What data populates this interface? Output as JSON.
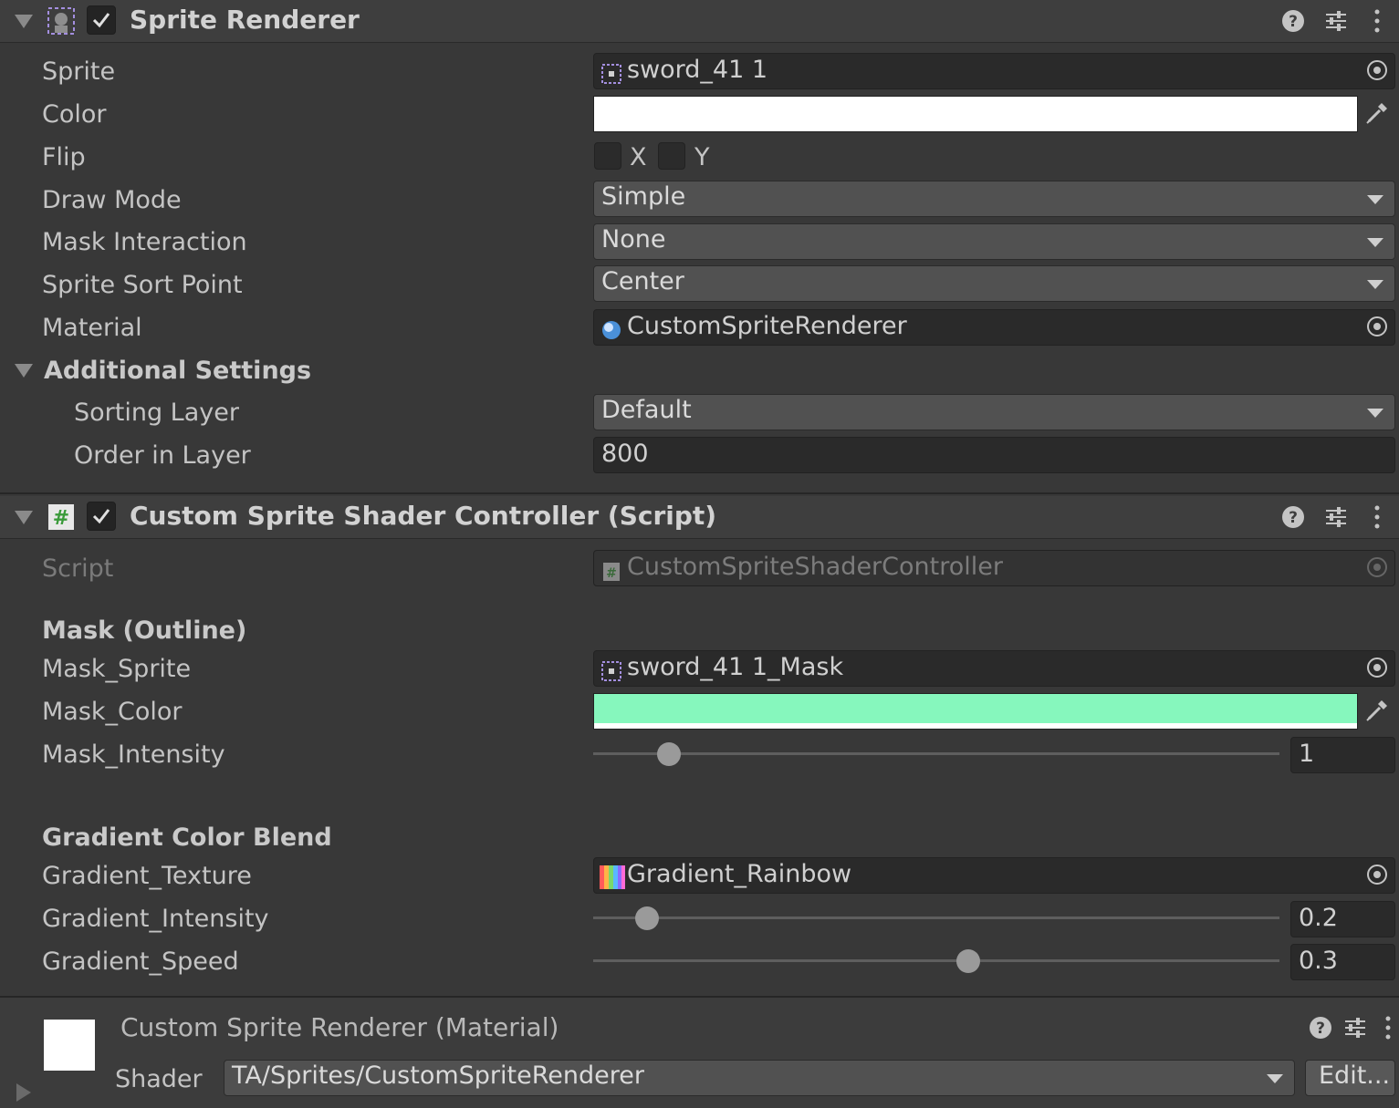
{
  "sprite_renderer": {
    "title": "Sprite Renderer",
    "enabled": true,
    "fields": {
      "sprite_label": "Sprite",
      "sprite_value": "sword_41 1",
      "color_label": "Color",
      "color_value": "#ffffff",
      "flip_label": "Flip",
      "flip_x": "X",
      "flip_y": "Y",
      "draw_mode_label": "Draw Mode",
      "draw_mode_value": "Simple",
      "mask_interaction_label": "Mask Interaction",
      "mask_interaction_value": "None",
      "sprite_sort_point_label": "Sprite Sort Point",
      "sprite_sort_point_value": "Center",
      "material_label": "Material",
      "material_value": "CustomSpriteRenderer"
    },
    "additional": {
      "title": "Additional Settings",
      "sorting_layer_label": "Sorting Layer",
      "sorting_layer_value": "Default",
      "order_label": "Order in Layer",
      "order_value": "800"
    }
  },
  "shader_controller": {
    "title": "Custom Sprite Shader Controller (Script)",
    "enabled": true,
    "script_label": "Script",
    "script_value": "CustomSpriteShaderController",
    "mask_section": "Mask (Outline)",
    "mask_sprite_label": "Mask_Sprite",
    "mask_sprite_value": "sword_41 1_Mask",
    "mask_color_label": "Mask_Color",
    "mask_color_value": "#86f7bd",
    "mask_intensity_label": "Mask_Intensity",
    "mask_intensity_value": "1",
    "mask_intensity_fraction": 0.11,
    "gradient_section": "Gradient Color Blend",
    "gradient_texture_label": "Gradient_Texture",
    "gradient_texture_value": "Gradient_Rainbow",
    "gradient_intensity_label": "Gradient_Intensity",
    "gradient_intensity_value": "0.2",
    "gradient_intensity_fraction": 0.078,
    "gradient_speed_label": "Gradient_Speed",
    "gradient_speed_value": "0.3",
    "gradient_speed_fraction": 0.547
  },
  "material": {
    "title": "Custom Sprite Renderer (Material)",
    "shader_label": "Shader",
    "shader_value": "TA/Sprites/CustomSpriteRenderer",
    "edit_label": "Edit..."
  },
  "icons": {
    "help": "help-icon",
    "presets": "presets-icon",
    "more": "more-icon",
    "picker": "object-picker-icon",
    "dropper": "eyedropper-icon"
  }
}
